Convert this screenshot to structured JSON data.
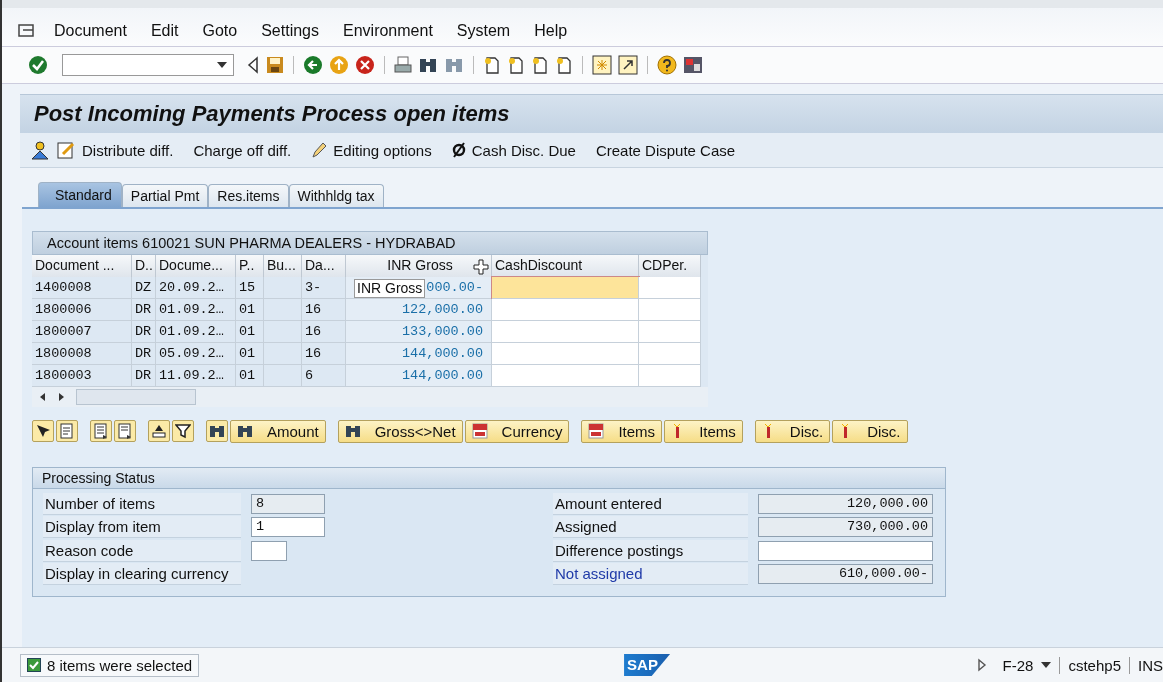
{
  "menu": [
    "Document",
    "Edit",
    "Goto",
    "Settings",
    "Environment",
    "System",
    "Help"
  ],
  "title": "Post Incoming Payments Process open items",
  "app_toolbar": [
    "Distribute diff.",
    "Charge off diff.",
    "Editing options",
    "Cash Disc. Due",
    "Create Dispute Case"
  ],
  "tabs": [
    {
      "label": "Standard",
      "selected": true
    },
    {
      "label": "Partial Pmt",
      "selected": false
    },
    {
      "label": "Res.items",
      "selected": false
    },
    {
      "label": "Withhldg tax",
      "selected": false
    }
  ],
  "table": {
    "title": "Account items 610021 SUN PHARMA DEALERS - HYDRABAD",
    "columns": [
      "Document ...",
      "D..",
      "Docume...",
      "P..",
      "Bu...",
      "Da...",
      "INR Gross",
      "CashDiscount",
      "CDPer."
    ],
    "rows": [
      {
        "cells": [
          "1400008",
          "DZ",
          "20.09.2…",
          "15",
          "",
          "3-",
          "000.00-",
          "",
          ""
        ],
        "selected_cell": true
      },
      {
        "cells": [
          "1800006",
          "DR",
          "01.09.2…",
          "01",
          "",
          "16",
          "122,000.00",
          "",
          ""
        ],
        "selected_cell": false
      },
      {
        "cells": [
          "1800007",
          "DR",
          "01.09.2…",
          "01",
          "",
          "16",
          "133,000.00",
          "",
          ""
        ],
        "selected_cell": false
      },
      {
        "cells": [
          "1800008",
          "DR",
          "05.09.2…",
          "01",
          "",
          "16",
          "144,000.00",
          "",
          ""
        ],
        "selected_cell": false
      },
      {
        "cells": [
          "1800003",
          "DR",
          "11.09.2…",
          "01",
          "",
          "6",
          "144,000.00",
          "",
          ""
        ],
        "selected_cell": false
      }
    ],
    "tooltip": "INR Gross"
  },
  "table_buttons": [
    "Amount",
    "Gross<>Net",
    "Currency",
    "Items",
    "Items",
    "Disc.",
    "Disc."
  ],
  "processing_status": {
    "title": "Processing Status",
    "left": [
      {
        "label": "Number of items",
        "value": "8",
        "editable": false
      },
      {
        "label": "Display from item",
        "value": "1",
        "editable": true
      },
      {
        "label": "Reason code",
        "editable": true
      },
      {
        "label": "Display in clearing currency"
      }
    ],
    "right": [
      {
        "label": "Amount entered",
        "value": "120,000.00",
        "editable": false,
        "kind": "label"
      },
      {
        "label": "Assigned",
        "value": "730,000.00",
        "editable": false,
        "kind": "label"
      },
      {
        "label": "Difference postings",
        "editable": true,
        "kind": "label"
      },
      {
        "label": "Not assigned",
        "value": "610,000.00-",
        "editable": false,
        "kind": "link"
      }
    ]
  },
  "status_bar": {
    "message": "8 items were selected",
    "logo": "SAP",
    "transaction": "F-28",
    "user": "cstehp5",
    "mode": "INS"
  }
}
